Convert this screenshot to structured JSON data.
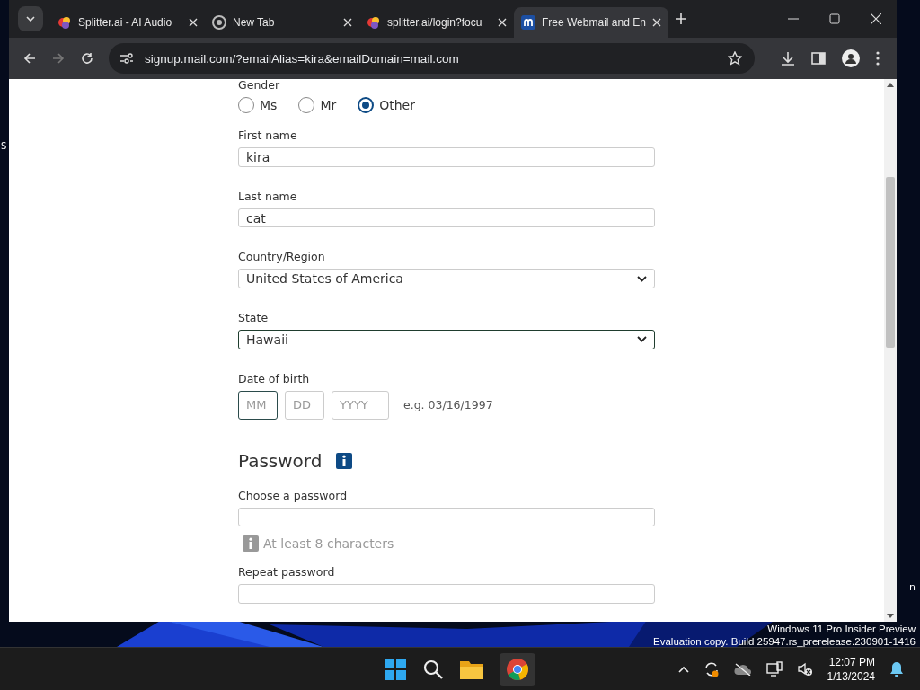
{
  "desktop": {
    "fragments": [
      "S",
      "n"
    ],
    "watermark": [
      "Windows 11 Pro Insider Preview",
      "Evaluation copy. Build 25947.rs_prerelease.230901-1416"
    ]
  },
  "browser": {
    "tabs": [
      {
        "title": "Splitter.ai - AI Audio",
        "kind": "splitter",
        "selected": false
      },
      {
        "title": "New Tab",
        "kind": "chrome",
        "selected": false
      },
      {
        "title": "splitter.ai/login?focu",
        "kind": "splitter",
        "selected": false
      },
      {
        "title": "Free Webmail and En",
        "kind": "mail",
        "selected": true
      }
    ],
    "address": "signup.mail.com/?emailAlias=kira&emailDomain=mail.com"
  },
  "form": {
    "gender": {
      "label": "Gender",
      "options": [
        {
          "label": "Ms",
          "selected": false
        },
        {
          "label": "Mr",
          "selected": false
        },
        {
          "label": "Other",
          "selected": true
        }
      ]
    },
    "fields": [
      {
        "kind": "text",
        "label": "First name",
        "value": "kira",
        "focused": false
      },
      {
        "kind": "text",
        "label": "Last name",
        "value": "cat",
        "focused": false
      },
      {
        "kind": "select",
        "label": "Country/Region",
        "value": "United States of America",
        "focused": false
      },
      {
        "kind": "select",
        "label": "State",
        "value": "Hawaii",
        "focused": true
      }
    ],
    "dob": {
      "label": "Date of birth",
      "parts": [
        {
          "placeholder": "MM",
          "focused": true
        },
        {
          "placeholder": "DD",
          "focused": false
        },
        {
          "placeholder": "YYYY",
          "focused": false
        }
      ],
      "hint": "e.g. 03/16/1997"
    },
    "password": {
      "title": "Password",
      "fields": [
        {
          "label": "Choose a password",
          "hint": "At least 8 characters"
        },
        {
          "label": "Repeat password"
        }
      ]
    }
  },
  "taskbar": {
    "time": "12:07 PM",
    "date": "1/13/2024"
  }
}
